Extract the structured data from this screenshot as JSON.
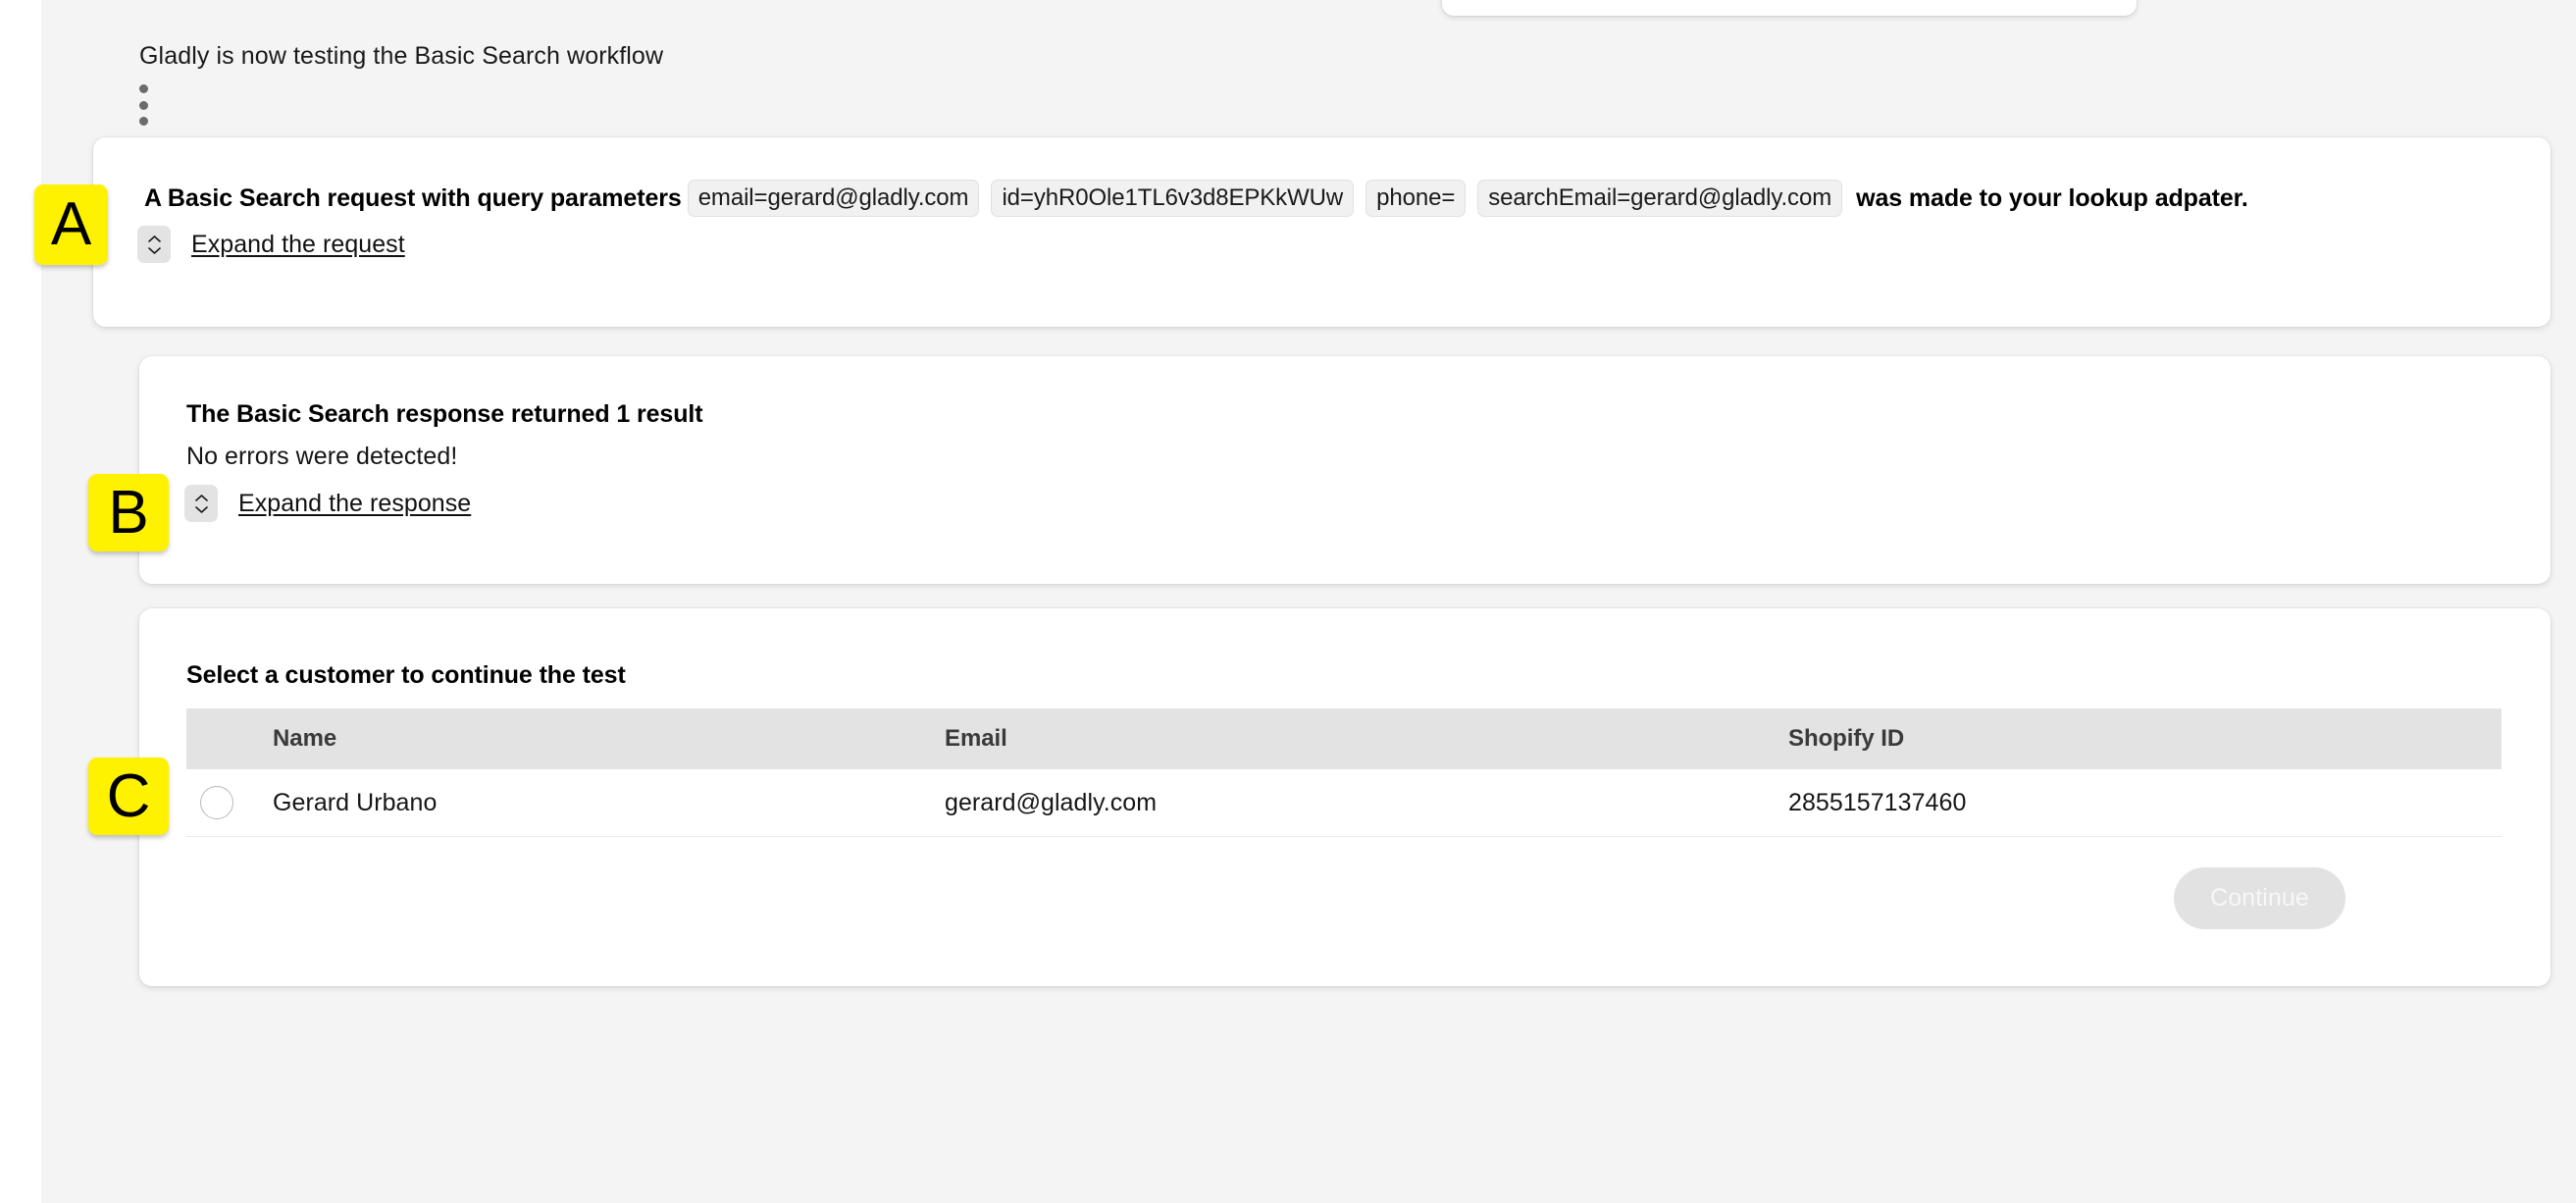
{
  "page": {
    "intro_text": "Gladly is now testing the Basic Search workflow",
    "kebab_menu_label": "more-options"
  },
  "annotations": {
    "a": "A",
    "b": "B",
    "c": "C"
  },
  "request_section": {
    "lead_text": "A Basic Search request with query parameters",
    "params": [
      "email=gerard@gladly.com",
      "id=yhR0Ole1TL6v3d8EPKkWUw",
      "phone=",
      "searchEmail=gerard@gladly.com"
    ],
    "tail_text": "was made to your lookup adpater.",
    "expand_label": "Expand the request"
  },
  "response_section": {
    "title": "The Basic Search response returned 1 result",
    "subtitle": "No errors were detected!",
    "expand_label": "Expand the response"
  },
  "customer_section": {
    "title": "Select a customer to continue the test",
    "columns": [
      "Name",
      "Email",
      "Shopify ID"
    ],
    "rows": [
      {
        "name": "Gerard Urbano",
        "email": "gerard@gladly.com",
        "shopify_id": "2855157137460",
        "selected": false
      }
    ],
    "continue_label": "Continue"
  },
  "colors": {
    "canvas_bg": "#f4f4f5",
    "card_bg": "#ffffff",
    "chip_bg": "#f1f1f1",
    "annotation_yellow": "#fff200",
    "table_header_bg": "#e3e3e3",
    "button_disabled_bg": "#e2e2e2"
  }
}
